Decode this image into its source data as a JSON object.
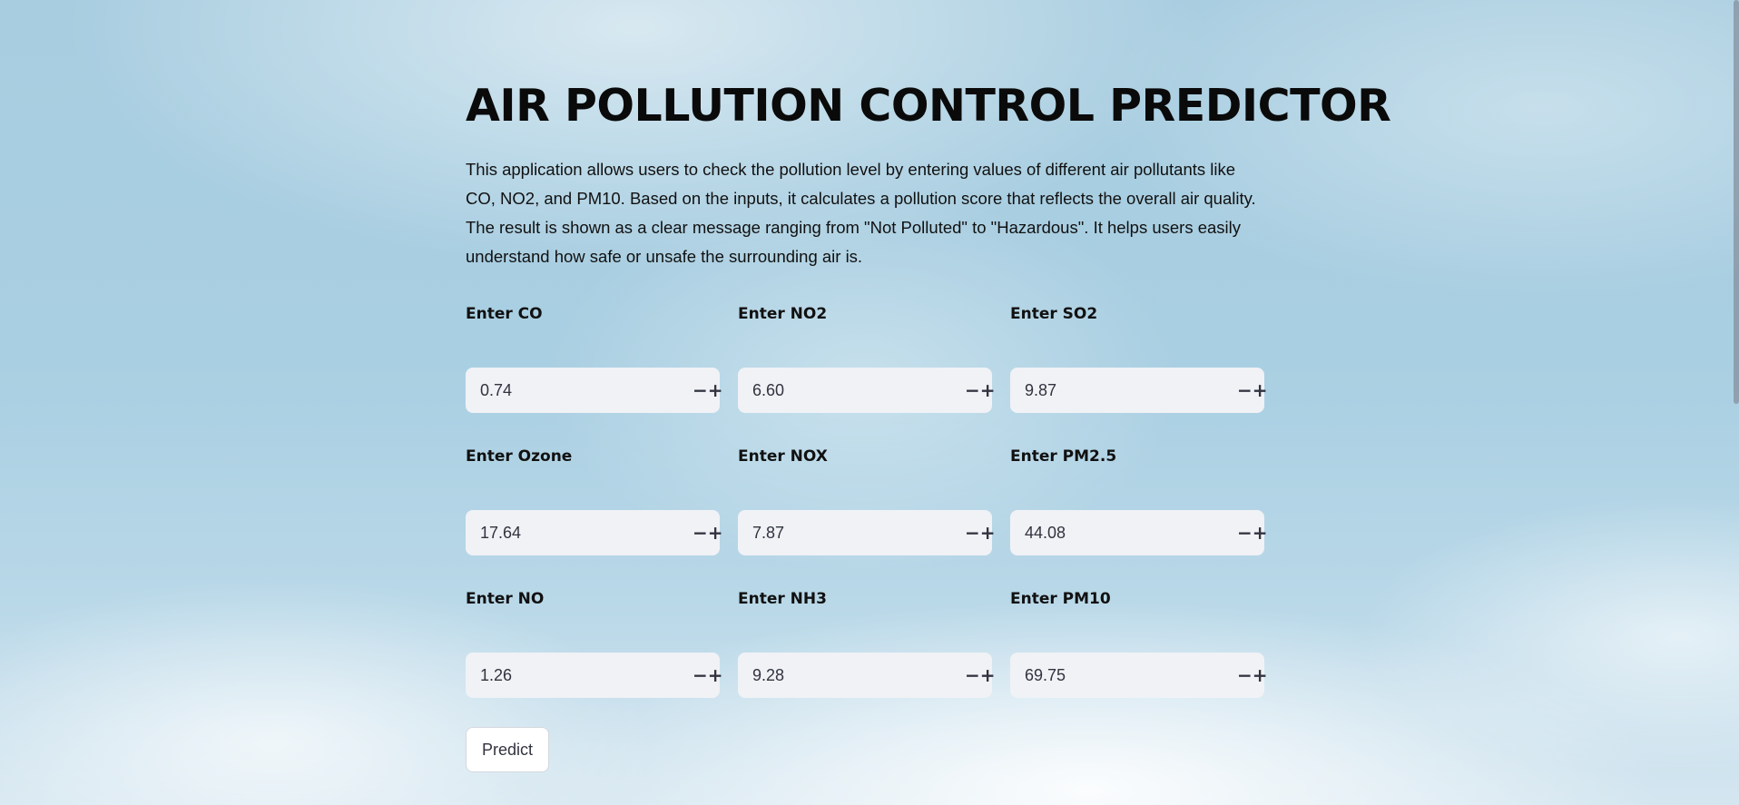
{
  "page": {
    "title": "AIR POLLUTION CONTROL PREDICTOR",
    "description": "This application allows users to check the pollution level by entering values of different air pollutants like CO, NO2, and PM10. Based on the inputs, it calculates a pollution score that reflects the overall air quality. The result is shown as a clear message ranging from \"Not Polluted\" to \"Hazardous\". It helps users easily understand how safe or unsafe the surrounding air is."
  },
  "stepper": {
    "minus": "−",
    "plus": "+"
  },
  "inputs": [
    {
      "label": "Enter CO",
      "value": "0.74"
    },
    {
      "label": "Enter NO2",
      "value": "6.60"
    },
    {
      "label": "Enter SO2",
      "value": "9.87"
    },
    {
      "label": "Enter Ozone",
      "value": "17.64"
    },
    {
      "label": "Enter NOX",
      "value": "7.87"
    },
    {
      "label": "Enter PM2.5",
      "value": "44.08"
    },
    {
      "label": "Enter NO",
      "value": "1.26"
    },
    {
      "label": "Enter NH3",
      "value": "9.28"
    },
    {
      "label": "Enter PM10",
      "value": "69.75"
    }
  ],
  "actions": {
    "predict_label": "Predict"
  },
  "colors": {
    "input_background": "#f0f2f6",
    "text": "#31333f",
    "sky": "#a8cde0"
  }
}
